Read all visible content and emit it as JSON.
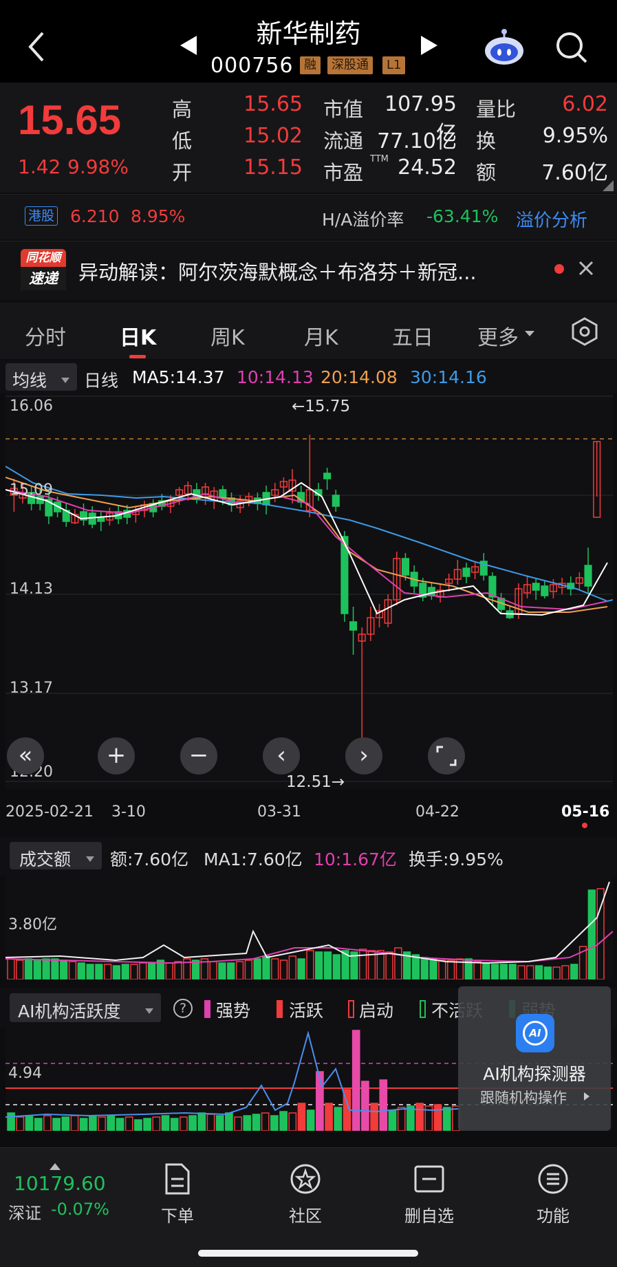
{
  "header": {
    "title": "新华制药",
    "code": "000756",
    "tags": [
      "融",
      "深股通",
      "L1"
    ]
  },
  "quote": {
    "price": "15.65",
    "change": "1.42",
    "change_pct": "9.98%",
    "high_label": "高",
    "high": "15.65",
    "low_label": "低",
    "low": "15.02",
    "open_label": "开",
    "open": "15.15",
    "mcap_label": "市值",
    "mcap": "107.95亿",
    "float_label": "流通",
    "float": "77.10亿",
    "pe_label": "市盈",
    "pe_sup": "TTM",
    "pe": "24.52",
    "vr_label": "量比",
    "vr": "6.02",
    "turn_label": "换",
    "turn": "9.95%",
    "amt_label": "额",
    "amt": "7.60亿"
  },
  "hk": {
    "badge": "港股",
    "price": "6.210",
    "pct": "8.95%",
    "premium_label": "H/A溢价率",
    "premium": "-63.41%",
    "link": "溢价分析"
  },
  "news": {
    "logo_top": "同花顺",
    "logo_bottom": "速递",
    "text": "异动解读：阿尔茨海默概念＋布洛芬＋新冠..."
  },
  "tabs": [
    "分时",
    "日K",
    "周K",
    "月K",
    "五日",
    "更多"
  ],
  "ma": {
    "selector": "均线",
    "period": "日线",
    "ma5": "MA5:14.37",
    "ma10": "10:14.13",
    "ma20": "20:14.08",
    "ma30": "30:14.16"
  },
  "chart": {
    "y_labels": [
      "16.06",
      "15.09",
      "14.13",
      "13.17",
      "12.20"
    ],
    "high_marker": "←15.75",
    "low_marker": "12.51→",
    "dates": [
      "2025-02-21",
      "3-10",
      "03-31",
      "04-22",
      "05-16"
    ]
  },
  "volume": {
    "selector": "成交额",
    "amt": "额:7.60亿",
    "ma1": "MA1:7.60亿",
    "ma10": "10:1.67亿",
    "turn": "换手:9.95%",
    "y_label": "3.80亿"
  },
  "ai": {
    "selector": "AI机构活跃度",
    "legend": [
      "强势",
      "活跃",
      "启动",
      "不活跃",
      "弱势"
    ],
    "y_label": "4.94",
    "card_title": "AI机构探测器",
    "card_sub": "跟随机构操作",
    "card_icon": "AI"
  },
  "bottom": {
    "index_value": "10179.60",
    "index_name": "深证",
    "index_change": "-0.07%",
    "items": [
      "下单",
      "社区",
      "删自选",
      "功能"
    ]
  },
  "colors": {
    "up": "#f23b3b",
    "down": "#1ec25c",
    "ma5": "#ffffff",
    "ma10": "#e040b0",
    "ma20": "#f0a050",
    "ma30": "#3d9be9",
    "accent": "#3d8bf5"
  }
}
